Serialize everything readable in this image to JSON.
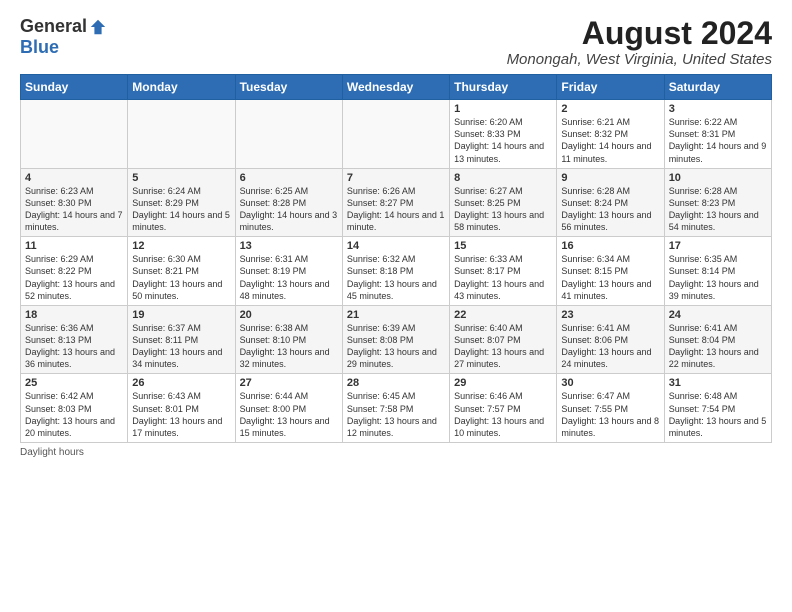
{
  "logo": {
    "general": "General",
    "blue": "Blue"
  },
  "title": "August 2024",
  "location": "Monongah, West Virginia, United States",
  "days_of_week": [
    "Sunday",
    "Monday",
    "Tuesday",
    "Wednesday",
    "Thursday",
    "Friday",
    "Saturday"
  ],
  "footer": "Daylight hours",
  "weeks": [
    [
      {
        "day": "",
        "info": ""
      },
      {
        "day": "",
        "info": ""
      },
      {
        "day": "",
        "info": ""
      },
      {
        "day": "",
        "info": ""
      },
      {
        "day": "1",
        "info": "Sunrise: 6:20 AM\nSunset: 8:33 PM\nDaylight: 14 hours\nand 13 minutes."
      },
      {
        "day": "2",
        "info": "Sunrise: 6:21 AM\nSunset: 8:32 PM\nDaylight: 14 hours\nand 11 minutes."
      },
      {
        "day": "3",
        "info": "Sunrise: 6:22 AM\nSunset: 8:31 PM\nDaylight: 14 hours\nand 9 minutes."
      }
    ],
    [
      {
        "day": "4",
        "info": "Sunrise: 6:23 AM\nSunset: 8:30 PM\nDaylight: 14 hours\nand 7 minutes."
      },
      {
        "day": "5",
        "info": "Sunrise: 6:24 AM\nSunset: 8:29 PM\nDaylight: 14 hours\nand 5 minutes."
      },
      {
        "day": "6",
        "info": "Sunrise: 6:25 AM\nSunset: 8:28 PM\nDaylight: 14 hours\nand 3 minutes."
      },
      {
        "day": "7",
        "info": "Sunrise: 6:26 AM\nSunset: 8:27 PM\nDaylight: 14 hours\nand 1 minute."
      },
      {
        "day": "8",
        "info": "Sunrise: 6:27 AM\nSunset: 8:25 PM\nDaylight: 13 hours\nand 58 minutes."
      },
      {
        "day": "9",
        "info": "Sunrise: 6:28 AM\nSunset: 8:24 PM\nDaylight: 13 hours\nand 56 minutes."
      },
      {
        "day": "10",
        "info": "Sunrise: 6:28 AM\nSunset: 8:23 PM\nDaylight: 13 hours\nand 54 minutes."
      }
    ],
    [
      {
        "day": "11",
        "info": "Sunrise: 6:29 AM\nSunset: 8:22 PM\nDaylight: 13 hours\nand 52 minutes."
      },
      {
        "day": "12",
        "info": "Sunrise: 6:30 AM\nSunset: 8:21 PM\nDaylight: 13 hours\nand 50 minutes."
      },
      {
        "day": "13",
        "info": "Sunrise: 6:31 AM\nSunset: 8:19 PM\nDaylight: 13 hours\nand 48 minutes."
      },
      {
        "day": "14",
        "info": "Sunrise: 6:32 AM\nSunset: 8:18 PM\nDaylight: 13 hours\nand 45 minutes."
      },
      {
        "day": "15",
        "info": "Sunrise: 6:33 AM\nSunset: 8:17 PM\nDaylight: 13 hours\nand 43 minutes."
      },
      {
        "day": "16",
        "info": "Sunrise: 6:34 AM\nSunset: 8:15 PM\nDaylight: 13 hours\nand 41 minutes."
      },
      {
        "day": "17",
        "info": "Sunrise: 6:35 AM\nSunset: 8:14 PM\nDaylight: 13 hours\nand 39 minutes."
      }
    ],
    [
      {
        "day": "18",
        "info": "Sunrise: 6:36 AM\nSunset: 8:13 PM\nDaylight: 13 hours\nand 36 minutes."
      },
      {
        "day": "19",
        "info": "Sunrise: 6:37 AM\nSunset: 8:11 PM\nDaylight: 13 hours\nand 34 minutes."
      },
      {
        "day": "20",
        "info": "Sunrise: 6:38 AM\nSunset: 8:10 PM\nDaylight: 13 hours\nand 32 minutes."
      },
      {
        "day": "21",
        "info": "Sunrise: 6:39 AM\nSunset: 8:08 PM\nDaylight: 13 hours\nand 29 minutes."
      },
      {
        "day": "22",
        "info": "Sunrise: 6:40 AM\nSunset: 8:07 PM\nDaylight: 13 hours\nand 27 minutes."
      },
      {
        "day": "23",
        "info": "Sunrise: 6:41 AM\nSunset: 8:06 PM\nDaylight: 13 hours\nand 24 minutes."
      },
      {
        "day": "24",
        "info": "Sunrise: 6:41 AM\nSunset: 8:04 PM\nDaylight: 13 hours\nand 22 minutes."
      }
    ],
    [
      {
        "day": "25",
        "info": "Sunrise: 6:42 AM\nSunset: 8:03 PM\nDaylight: 13 hours\nand 20 minutes."
      },
      {
        "day": "26",
        "info": "Sunrise: 6:43 AM\nSunset: 8:01 PM\nDaylight: 13 hours\nand 17 minutes."
      },
      {
        "day": "27",
        "info": "Sunrise: 6:44 AM\nSunset: 8:00 PM\nDaylight: 13 hours\nand 15 minutes."
      },
      {
        "day": "28",
        "info": "Sunrise: 6:45 AM\nSunset: 7:58 PM\nDaylight: 13 hours\nand 12 minutes."
      },
      {
        "day": "29",
        "info": "Sunrise: 6:46 AM\nSunset: 7:57 PM\nDaylight: 13 hours\nand 10 minutes."
      },
      {
        "day": "30",
        "info": "Sunrise: 6:47 AM\nSunset: 7:55 PM\nDaylight: 13 hours\nand 8 minutes."
      },
      {
        "day": "31",
        "info": "Sunrise: 6:48 AM\nSunset: 7:54 PM\nDaylight: 13 hours\nand 5 minutes."
      }
    ]
  ]
}
